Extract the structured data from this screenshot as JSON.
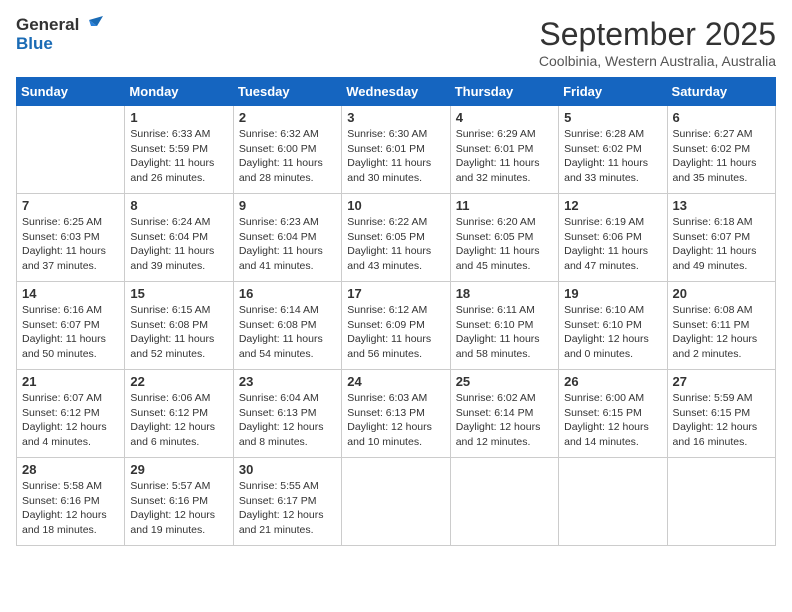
{
  "header": {
    "logo_line1": "General",
    "logo_line2": "Blue",
    "title": "September 2025",
    "subtitle": "Coolbinia, Western Australia, Australia"
  },
  "days_of_week": [
    "Sunday",
    "Monday",
    "Tuesday",
    "Wednesday",
    "Thursday",
    "Friday",
    "Saturday"
  ],
  "weeks": [
    [
      {
        "day": "",
        "info": ""
      },
      {
        "day": "1",
        "info": "Sunrise: 6:33 AM\nSunset: 5:59 PM\nDaylight: 11 hours\nand 26 minutes."
      },
      {
        "day": "2",
        "info": "Sunrise: 6:32 AM\nSunset: 6:00 PM\nDaylight: 11 hours\nand 28 minutes."
      },
      {
        "day": "3",
        "info": "Sunrise: 6:30 AM\nSunset: 6:01 PM\nDaylight: 11 hours\nand 30 minutes."
      },
      {
        "day": "4",
        "info": "Sunrise: 6:29 AM\nSunset: 6:01 PM\nDaylight: 11 hours\nand 32 minutes."
      },
      {
        "day": "5",
        "info": "Sunrise: 6:28 AM\nSunset: 6:02 PM\nDaylight: 11 hours\nand 33 minutes."
      },
      {
        "day": "6",
        "info": "Sunrise: 6:27 AM\nSunset: 6:02 PM\nDaylight: 11 hours\nand 35 minutes."
      }
    ],
    [
      {
        "day": "7",
        "info": "Sunrise: 6:25 AM\nSunset: 6:03 PM\nDaylight: 11 hours\nand 37 minutes."
      },
      {
        "day": "8",
        "info": "Sunrise: 6:24 AM\nSunset: 6:04 PM\nDaylight: 11 hours\nand 39 minutes."
      },
      {
        "day": "9",
        "info": "Sunrise: 6:23 AM\nSunset: 6:04 PM\nDaylight: 11 hours\nand 41 minutes."
      },
      {
        "day": "10",
        "info": "Sunrise: 6:22 AM\nSunset: 6:05 PM\nDaylight: 11 hours\nand 43 minutes."
      },
      {
        "day": "11",
        "info": "Sunrise: 6:20 AM\nSunset: 6:05 PM\nDaylight: 11 hours\nand 45 minutes."
      },
      {
        "day": "12",
        "info": "Sunrise: 6:19 AM\nSunset: 6:06 PM\nDaylight: 11 hours\nand 47 minutes."
      },
      {
        "day": "13",
        "info": "Sunrise: 6:18 AM\nSunset: 6:07 PM\nDaylight: 11 hours\nand 49 minutes."
      }
    ],
    [
      {
        "day": "14",
        "info": "Sunrise: 6:16 AM\nSunset: 6:07 PM\nDaylight: 11 hours\nand 50 minutes."
      },
      {
        "day": "15",
        "info": "Sunrise: 6:15 AM\nSunset: 6:08 PM\nDaylight: 11 hours\nand 52 minutes."
      },
      {
        "day": "16",
        "info": "Sunrise: 6:14 AM\nSunset: 6:08 PM\nDaylight: 11 hours\nand 54 minutes."
      },
      {
        "day": "17",
        "info": "Sunrise: 6:12 AM\nSunset: 6:09 PM\nDaylight: 11 hours\nand 56 minutes."
      },
      {
        "day": "18",
        "info": "Sunrise: 6:11 AM\nSunset: 6:10 PM\nDaylight: 11 hours\nand 58 minutes."
      },
      {
        "day": "19",
        "info": "Sunrise: 6:10 AM\nSunset: 6:10 PM\nDaylight: 12 hours\nand 0 minutes."
      },
      {
        "day": "20",
        "info": "Sunrise: 6:08 AM\nSunset: 6:11 PM\nDaylight: 12 hours\nand 2 minutes."
      }
    ],
    [
      {
        "day": "21",
        "info": "Sunrise: 6:07 AM\nSunset: 6:12 PM\nDaylight: 12 hours\nand 4 minutes."
      },
      {
        "day": "22",
        "info": "Sunrise: 6:06 AM\nSunset: 6:12 PM\nDaylight: 12 hours\nand 6 minutes."
      },
      {
        "day": "23",
        "info": "Sunrise: 6:04 AM\nSunset: 6:13 PM\nDaylight: 12 hours\nand 8 minutes."
      },
      {
        "day": "24",
        "info": "Sunrise: 6:03 AM\nSunset: 6:13 PM\nDaylight: 12 hours\nand 10 minutes."
      },
      {
        "day": "25",
        "info": "Sunrise: 6:02 AM\nSunset: 6:14 PM\nDaylight: 12 hours\nand 12 minutes."
      },
      {
        "day": "26",
        "info": "Sunrise: 6:00 AM\nSunset: 6:15 PM\nDaylight: 12 hours\nand 14 minutes."
      },
      {
        "day": "27",
        "info": "Sunrise: 5:59 AM\nSunset: 6:15 PM\nDaylight: 12 hours\nand 16 minutes."
      }
    ],
    [
      {
        "day": "28",
        "info": "Sunrise: 5:58 AM\nSunset: 6:16 PM\nDaylight: 12 hours\nand 18 minutes."
      },
      {
        "day": "29",
        "info": "Sunrise: 5:57 AM\nSunset: 6:16 PM\nDaylight: 12 hours\nand 19 minutes."
      },
      {
        "day": "30",
        "info": "Sunrise: 5:55 AM\nSunset: 6:17 PM\nDaylight: 12 hours\nand 21 minutes."
      },
      {
        "day": "",
        "info": ""
      },
      {
        "day": "",
        "info": ""
      },
      {
        "day": "",
        "info": ""
      },
      {
        "day": "",
        "info": ""
      }
    ]
  ]
}
